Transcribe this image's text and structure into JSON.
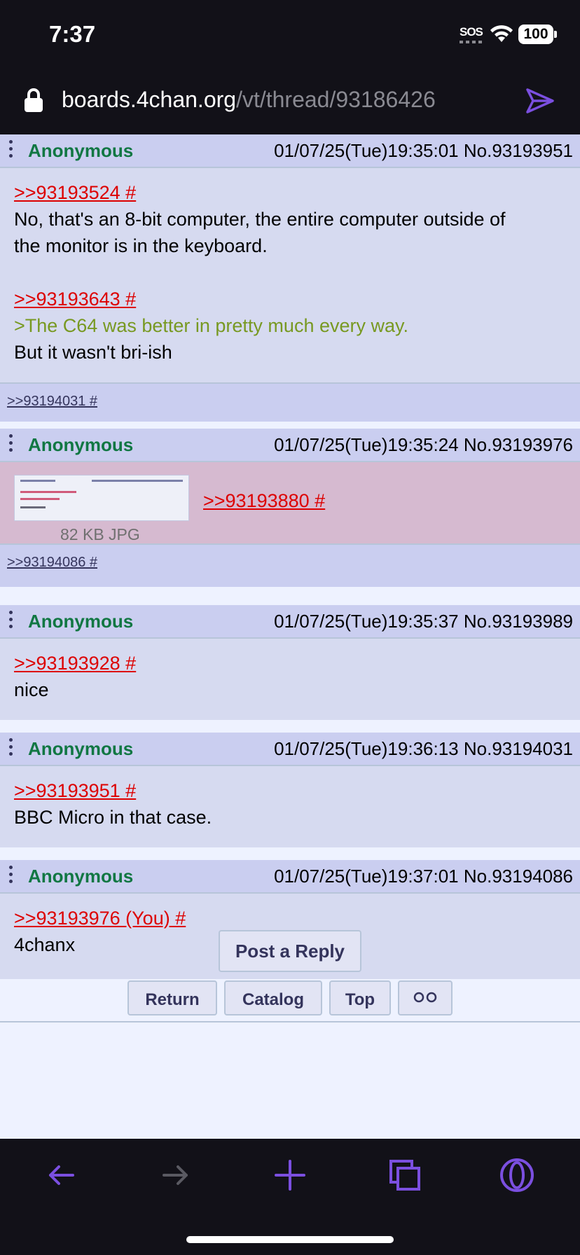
{
  "status_bar": {
    "time": "7:37",
    "sos": "SOS",
    "battery": "100"
  },
  "browser": {
    "url_domain": "boards.4chan.org",
    "url_path": "/vt/thread/93186426"
  },
  "posts": [
    {
      "name": "Anonymous",
      "datetime": "01/07/25(Tue)19:35:01 No.93193951",
      "quote1": ">>93193524 #",
      "text1": "No, that's an 8-bit computer, the entire computer outside of",
      "text2": "the monitor is in the keyboard.",
      "quote2": ">>93193643 #",
      "greentext": ">The C64 was better in pretty much every way.",
      "text3": "But it wasn't bri-ish",
      "backlink": ">>93194031 #"
    },
    {
      "name": "Anonymous",
      "datetime": "01/07/25(Tue)19:35:24 No.93193976",
      "quote": ">>93193880 #",
      "fileinfo": "82 KB JPG",
      "backlink": ">>93194086 #"
    },
    {
      "name": "Anonymous",
      "datetime": "01/07/25(Tue)19:35:37 No.93193989",
      "quote": ">>93193928 #",
      "text": "nice"
    },
    {
      "name": "Anonymous",
      "datetime": "01/07/25(Tue)19:36:13 No.93194031",
      "quote": ">>93193951 #",
      "text": "BBC Micro in that case."
    },
    {
      "name": "Anonymous",
      "datetime": "01/07/25(Tue)19:37:01 No.93194086",
      "quote": ">>93193976 (You) #",
      "text": "4chanx"
    }
  ],
  "footer": {
    "post_reply": "Post a Reply",
    "return": "Return",
    "catalog": "Catalog",
    "top": "Top"
  },
  "colors": {
    "accent": "#7b4fe0",
    "quotelink": "#dd0000",
    "name": "#117743",
    "greentext": "#789922"
  }
}
